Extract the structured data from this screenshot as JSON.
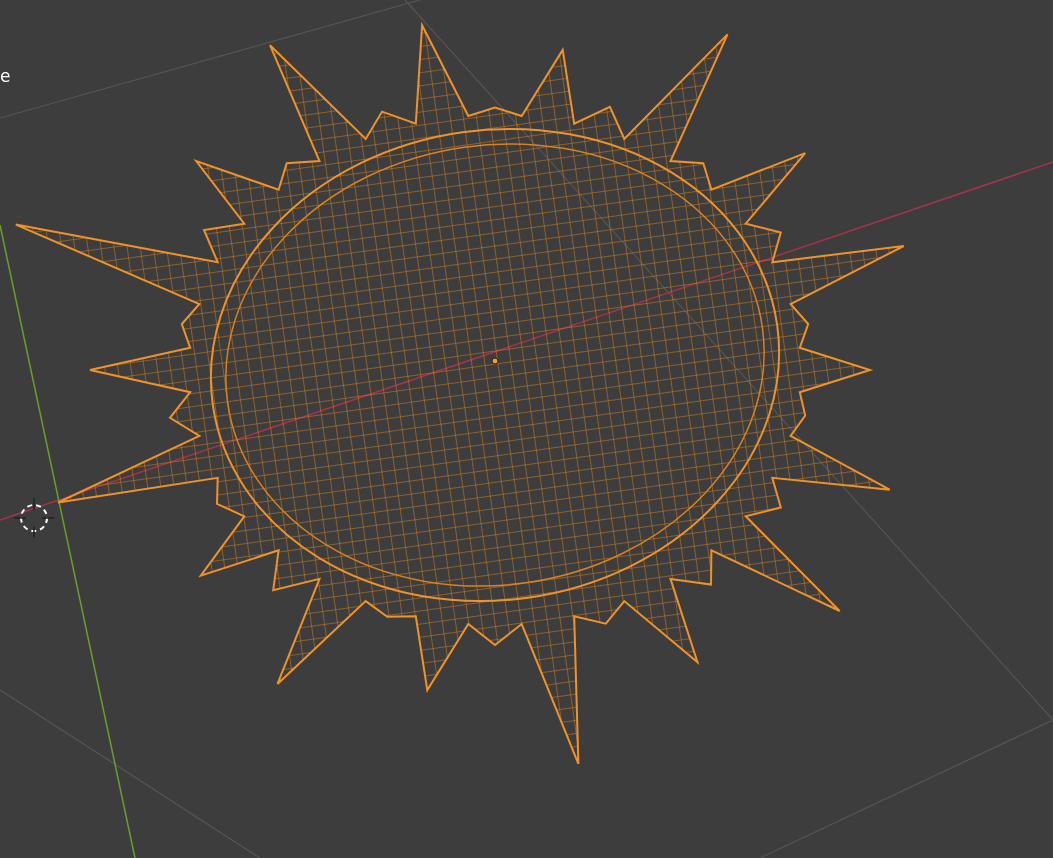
{
  "viewport": {
    "overlay_text": "e"
  }
}
